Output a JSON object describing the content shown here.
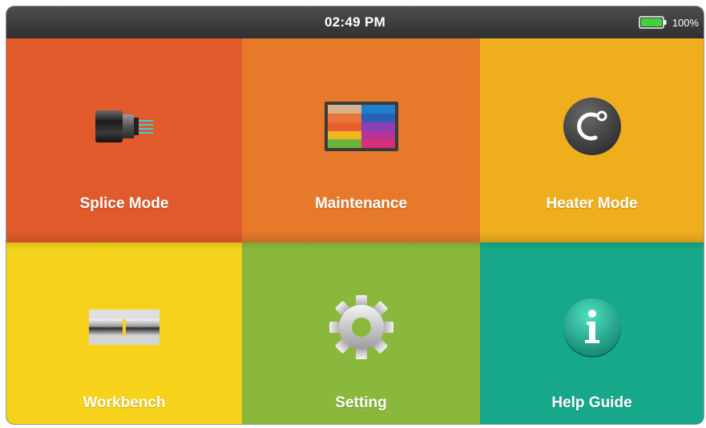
{
  "status_bar": {
    "time": "02:49 PM",
    "battery_percent": "100%",
    "battery_level": 1.0,
    "battery_color": "#3fd43a"
  },
  "menu": {
    "tiles": [
      {
        "label": "Splice Mode",
        "color": "#e05a2b",
        "icon": "fiber-connector-icon"
      },
      {
        "label": "Maintenance",
        "color": "#e67a2a",
        "icon": "color-bars-icon"
      },
      {
        "label": "Heater Mode",
        "color": "#efae1e",
        "icon": "temperature-celsius-icon"
      },
      {
        "label": "Workbench",
        "color": "#f6d21a",
        "icon": "fiber-alignment-icon"
      },
      {
        "label": "Setting",
        "color": "#8ab83c",
        "icon": "gear-icon"
      },
      {
        "label": "Help Guide",
        "color": "#17a88a",
        "icon": "info-icon"
      }
    ]
  }
}
